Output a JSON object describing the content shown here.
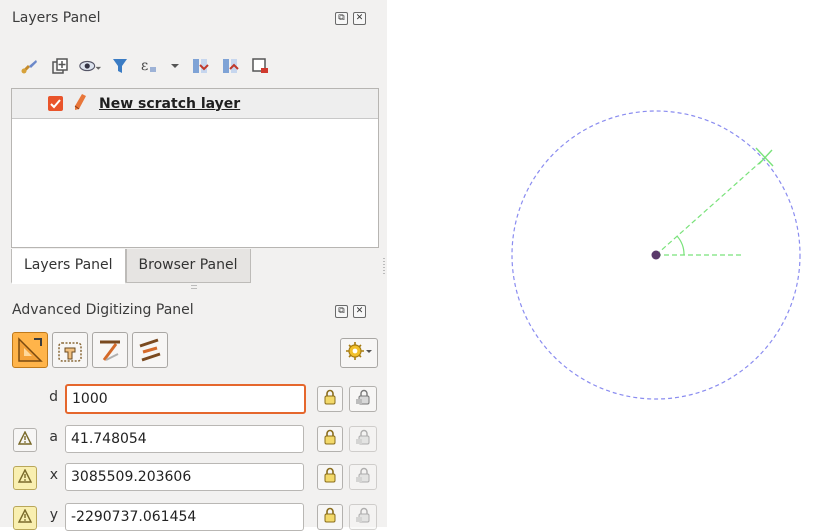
{
  "layers_panel": {
    "title": "Layers Panel",
    "dock_buttons": [
      "float-icon",
      "close-icon"
    ],
    "toolbar": [
      "style-brush-icon",
      "add-group-icon",
      "visibility-icon",
      "filter-icon",
      "filter-expression-icon",
      "dropdown-arrow-icon",
      "expand-all-icon",
      "collapse-all-icon",
      "remove-layer-icon"
    ],
    "layer": {
      "name": "New scratch layer",
      "checked": true,
      "editing": true
    }
  },
  "tabs": [
    {
      "label": "Layers Panel",
      "active": true
    },
    {
      "label": "Browser Panel",
      "active": false
    }
  ],
  "adv_panel": {
    "title": "Advanced Digitizing Panel",
    "mode_buttons": [
      "enable-advanced-digitizing-icon",
      "construction-mode-icon",
      "perpendicular-icon",
      "parallel-icon"
    ],
    "settings_icon": "settings-gear-icon",
    "fields": [
      {
        "key": "d",
        "label": "d",
        "value": "1000",
        "focused": true,
        "relative_lock": false,
        "relative_lock_active": false
      },
      {
        "key": "a",
        "label": "a",
        "value": "41.748054",
        "focused": false,
        "relative_lock": true,
        "relative_lock_active": false
      },
      {
        "key": "x",
        "label": "x",
        "value": "3085509.203606",
        "focused": false,
        "relative_lock": true,
        "relative_lock_active": true
      },
      {
        "key": "y",
        "label": "y",
        "value": "-2290737.061454",
        "focused": false,
        "relative_lock": true,
        "relative_lock_active": true
      }
    ]
  },
  "map": {
    "circle_color": "#8a8cf0",
    "guide_color": "#79e27a",
    "point_color": "#5a3a6a"
  }
}
